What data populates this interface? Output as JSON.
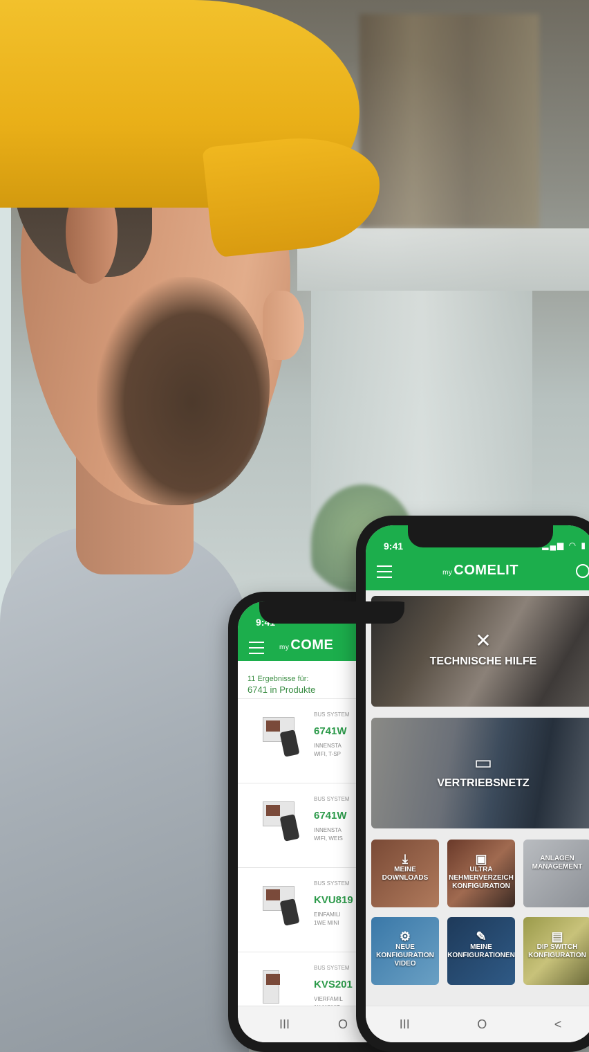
{
  "phone_back": {
    "time": "9:41",
    "logo_prefix": "my",
    "logo_main": "COME",
    "results_label": "11 Ergebnisse für:",
    "results_query": "6741 in Produkte",
    "products": [
      {
        "category": "BUS SYSTEM",
        "code": "6741W",
        "desc1": "INNENSTA",
        "desc2": "WIFI, T-SP"
      },
      {
        "category": "BUS SYSTEM",
        "code": "6741W",
        "desc1": "INNENSTA",
        "desc2": "WIFI, WEIS"
      },
      {
        "category": "BUS SYSTEM",
        "code": "KVU819",
        "desc1": "EINFAMILI",
        "desc2": "1WE MINI"
      },
      {
        "category": "BUS SYSTEM",
        "code": "KVS201",
        "desc1": "VIERFAMIL",
        "desc2": "1X MONIT"
      }
    ],
    "nav": [
      "III",
      "O"
    ]
  },
  "phone_front": {
    "time": "9:41",
    "logo_prefix": "my",
    "logo_main": "COMELIT",
    "tiles_hero": [
      "TECHNISCHE HILFE",
      "VERTRIEBSNETZ"
    ],
    "tiles_small": [
      {
        "line1": "MEINE",
        "line2": "DOWNLOADS"
      },
      {
        "line1": "ULTRA",
        "line2": "NEHMERVERZEICH",
        "line3": "KONFIGURATION"
      },
      {
        "line1": "ANLAGEN",
        "line2": "MANAGEMENT"
      },
      {
        "line1": "NEUE",
        "line2": "KONFIGURATION",
        "line3": "VIDEO"
      },
      {
        "line1": "MEINE",
        "line2": "KONFIGURATIONEN"
      },
      {
        "line1": "DIP SWITCH",
        "line2": "KONFIGURATION"
      }
    ],
    "nav": [
      "III",
      "O",
      "<"
    ]
  },
  "colors": {
    "accent": "#1cae4c",
    "helmet": "#f2c12c"
  }
}
